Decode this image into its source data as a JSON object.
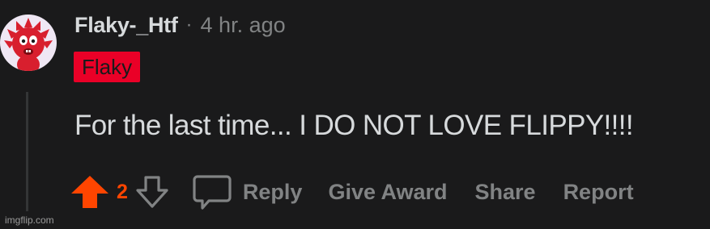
{
  "comment": {
    "author": "Flaky-_Htf",
    "separator": "·",
    "timestamp": "4 hr. ago",
    "flair": "Flaky",
    "text": "For the last time... I DO NOT LOVE FLIPPY!!!!",
    "avatar_icon": "avatar-icon"
  },
  "actions": {
    "upvote_icon": "upvote-arrow-icon",
    "vote_count": "2",
    "downvote_icon": "downvote-arrow-icon",
    "reply_icon": "speech-bubble-icon",
    "reply_label": "Reply",
    "award_label": "Give Award",
    "share_label": "Share",
    "report_label": "Report"
  },
  "colors": {
    "background": "#1a1a1b",
    "upvote": "#ff4500",
    "flair_background": "#ea0027",
    "muted_text": "#818384",
    "primary_text": "#d7dadc"
  },
  "watermark": "imgflip.com"
}
